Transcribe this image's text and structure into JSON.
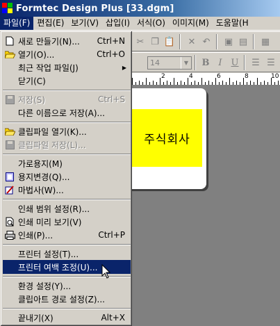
{
  "window": {
    "title": "Formtec Design Plus [33.dgm]"
  },
  "menubar": {
    "items": [
      {
        "label": "파일(F)",
        "active": true
      },
      {
        "label": "편집(E)"
      },
      {
        "label": "보기(V)"
      },
      {
        "label": "삽입(I)"
      },
      {
        "label": "서식(O)"
      },
      {
        "label": "이미지(M)"
      },
      {
        "label": "도움말(H"
      }
    ]
  },
  "toolbar": {
    "font_size_value": "14"
  },
  "ruler": {
    "labels": [
      "2",
      "4",
      "6",
      "8",
      "10"
    ]
  },
  "document": {
    "text_box": "주식회사",
    "text_box_color": "#ffff00"
  },
  "file_menu": {
    "items": [
      {
        "label": "새로 만들기(N)...",
        "shortcut": "Ctrl+N",
        "icon": "new-document-icon"
      },
      {
        "label": "열기(O)...",
        "shortcut": "Ctrl+O",
        "icon": "open-folder-icon"
      },
      {
        "label": "최근 작업 파일(J)",
        "submenu": true
      },
      {
        "label": "닫기(C)"
      },
      {
        "label": "저장(S)",
        "shortcut": "Ctrl+S",
        "disabled": true,
        "icon": "save-disk-icon"
      },
      {
        "label": "다른 이름으로 저장(A)..."
      },
      {
        "label": "클립파일 열기(K)...",
        "icon": "open-folder-icon"
      },
      {
        "label": "클립파일 저장(L)...",
        "disabled": true,
        "icon": "save-disk-icon"
      },
      {
        "label": "가로용지(M)"
      },
      {
        "label": "용지변경(Q)...",
        "icon": "paper-icon"
      },
      {
        "label": "마법사(W)...",
        "icon": "wizard-icon"
      },
      {
        "label": "인쇄 범위 설정(R)..."
      },
      {
        "label": "인쇄 미리 보기(V)",
        "icon": "print-preview-icon"
      },
      {
        "label": "인쇄(P)...",
        "shortcut": "Ctrl+P",
        "icon": "printer-icon"
      },
      {
        "label": "프린터 설정(T)..."
      },
      {
        "label": "프린터 여백 조정(U)...",
        "highlighted": true
      },
      {
        "label": "환경 설정(Y)..."
      },
      {
        "label": "클립아트 경로 설정(Z)..."
      },
      {
        "label": "끝내기(X)",
        "shortcut": "Alt+X"
      }
    ]
  },
  "colors": {
    "titlebar": "#0a246a",
    "highlight": "#0a246a",
    "workspace": "#808080"
  }
}
